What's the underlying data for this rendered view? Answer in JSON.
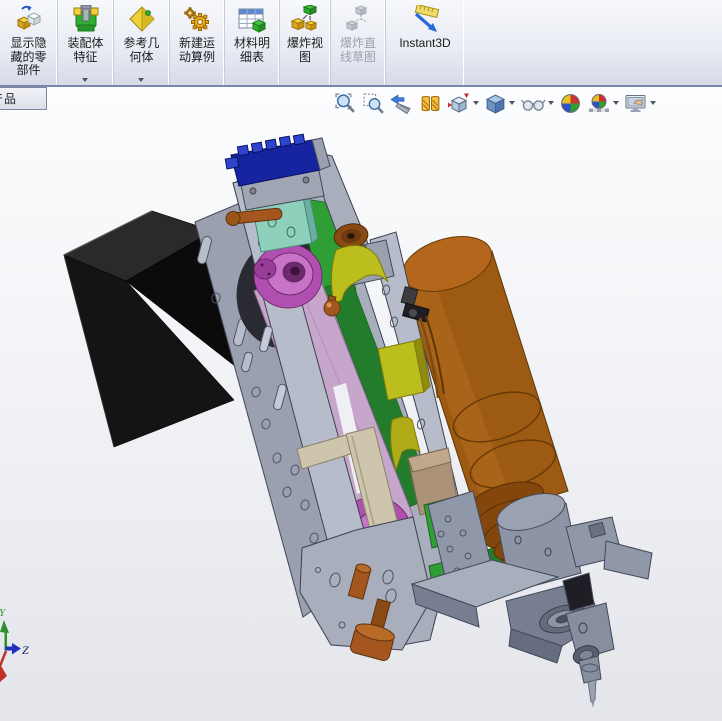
{
  "ribbon": {
    "buttons": [
      {
        "label": "显示隐藏的零部件",
        "icon": "show-hide-components-icon",
        "dropdown": false,
        "disabled": false
      },
      {
        "label": "装配体特征",
        "icon": "assembly-features-icon",
        "dropdown": true,
        "disabled": false
      },
      {
        "label": "参考几何体",
        "icon": "reference-geometry-icon",
        "dropdown": true,
        "disabled": false
      },
      {
        "label": "新建运动算例",
        "icon": "new-motion-study-icon",
        "dropdown": false,
        "disabled": false
      },
      {
        "label": "材料明细表",
        "icon": "bill-of-materials-icon",
        "dropdown": false,
        "disabled": false
      },
      {
        "label": "爆炸视图",
        "icon": "exploded-view-icon",
        "dropdown": false,
        "disabled": false
      },
      {
        "label": "爆炸直线草图",
        "icon": "explode-line-sketch-icon",
        "dropdown": false,
        "disabled": true
      },
      {
        "label": "Instant3D",
        "icon": "instant3d-icon",
        "dropdown": false,
        "disabled": false
      }
    ]
  },
  "document_tab": {
    "label": "产品"
  },
  "headsup_toolbar": {
    "items": [
      {
        "name": "zoom-to-fit",
        "dropdown": false
      },
      {
        "name": "zoom-to-area",
        "dropdown": false
      },
      {
        "name": "previous-view",
        "dropdown": false
      },
      {
        "name": "section-view",
        "dropdown": false
      },
      {
        "name": "view-orientation",
        "dropdown": true
      },
      {
        "name": "display-style",
        "dropdown": true
      },
      {
        "name": "hide-show-items",
        "dropdown": true
      },
      {
        "name": "edit-appearance",
        "dropdown": false
      },
      {
        "name": "apply-scene",
        "dropdown": true
      },
      {
        "name": "view-settings",
        "dropdown": true
      }
    ]
  },
  "triad": {
    "y_label": "Y",
    "z_label": "Z",
    "x_color": "#c03028",
    "y_color": "#2e8f2e",
    "z_color": "#2233bb"
  },
  "model": {
    "description": "Tilted belt-driven drilling / tapping spindle unit assembly shown in isometric view",
    "model_colors": {
      "frame": "#a8aebb",
      "frame-light": "#b6bcc9",
      "mount-plate": "#9aa0af",
      "hole-dark": "#2a2a32",
      "inner-dark": "#5a5f6c",
      "motor": "#141414",
      "motor-top": "#2a2a2a",
      "motor-side": "#0b0b0b",
      "servo": "#16249f",
      "servo-light": "#2e44cc",
      "teal": "#8fd0bd",
      "green": "#2f9e35",
      "green-dark": "#237c2b",
      "belt": "#c6a6ca",
      "pulley": "#b14fb1",
      "pulley-face": "#c873c8",
      "pulley-hub": "#6e2a6e",
      "orange": "#9c5a12",
      "orange-top": "#b4671c",
      "bellows": "#83470c",
      "collar": "#8d94a5",
      "tan": "#cec6ac",
      "tan-dark": "#ab9279",
      "yellow": "#bcbe1e",
      "copper": "#a4561e",
      "base": "#9097a8",
      "base-light": "#a7aebc",
      "base-dark": "#777e91",
      "black-detail": "#1e1e24",
      "steel": "#868ea0"
    }
  }
}
